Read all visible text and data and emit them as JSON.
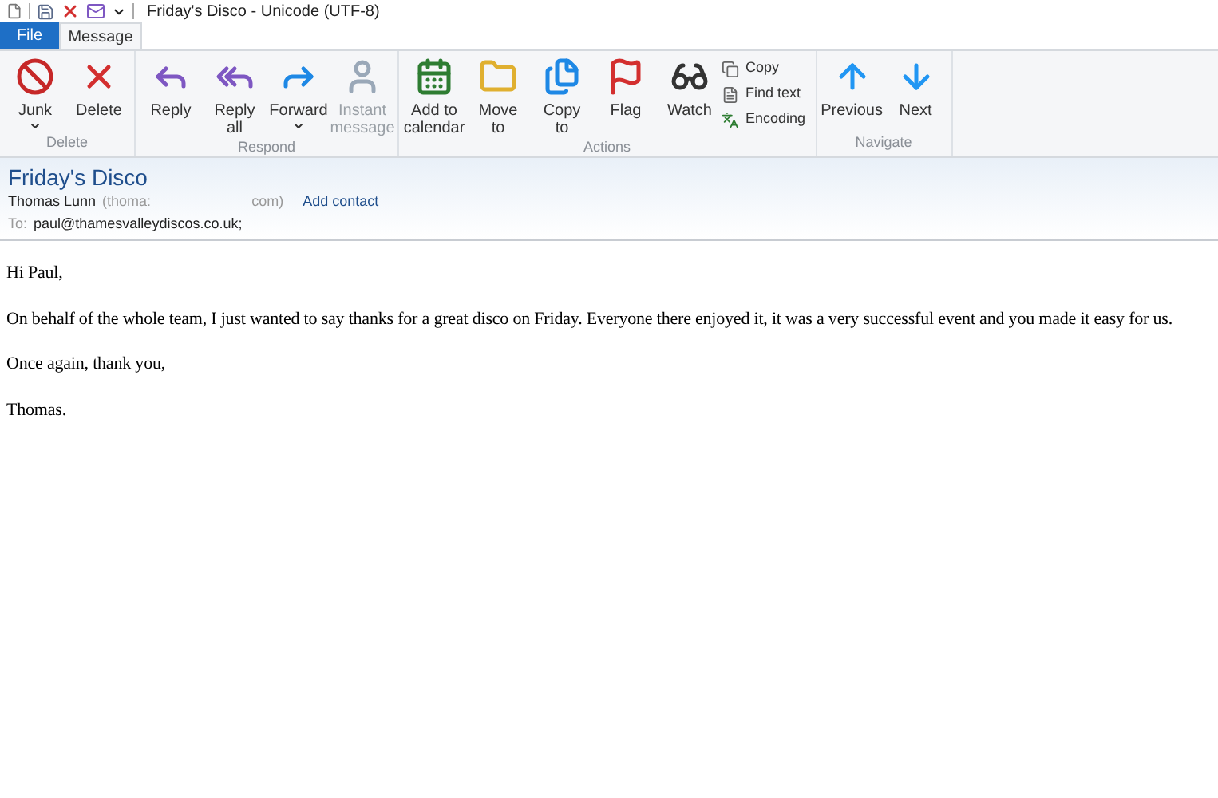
{
  "window": {
    "title": "Friday's Disco  - Unicode (UTF-8)"
  },
  "tabs": [
    {
      "label": "File",
      "selected": false,
      "kind": "file"
    },
    {
      "label": "Message",
      "selected": true,
      "kind": "tab"
    }
  ],
  "ribbon": {
    "groups": [
      {
        "label": "Delete",
        "buttons": [
          {
            "label": "Junk",
            "dropdown": true,
            "disabled": false
          },
          {
            "label": "Delete",
            "dropdown": false,
            "disabled": false
          }
        ]
      },
      {
        "label": "Respond",
        "buttons": [
          {
            "label": "Reply",
            "dropdown": false,
            "disabled": false
          },
          {
            "label": "Reply all",
            "dropdown": false,
            "disabled": false
          },
          {
            "label": "Forward",
            "dropdown": true,
            "disabled": false
          },
          {
            "label": "Instant message",
            "dropdown": false,
            "disabled": true
          }
        ]
      },
      {
        "label": "Actions",
        "buttons": [
          {
            "label": "Add to calendar",
            "dropdown": false,
            "disabled": false
          },
          {
            "label": "Move to",
            "dropdown": false,
            "disabled": false
          },
          {
            "label": "Copy to",
            "dropdown": false,
            "disabled": false
          },
          {
            "label": "Flag",
            "dropdown": false,
            "disabled": false
          },
          {
            "label": "Watch",
            "dropdown": false,
            "disabled": false
          }
        ],
        "small_buttons": [
          {
            "label": "Copy"
          },
          {
            "label": "Find text"
          },
          {
            "label": "Encoding"
          }
        ]
      },
      {
        "label": "Navigate",
        "buttons": [
          {
            "label": "Previous",
            "dropdown": false,
            "disabled": false
          },
          {
            "label": "Next",
            "dropdown": false,
            "disabled": false
          }
        ]
      }
    ]
  },
  "header": {
    "subject": "Friday's Disco",
    "sender": "Thomas Lunn",
    "sender_email_start": "(thoma:",
    "sender_email_end": "com)",
    "add_contact": "Add contact",
    "to_label": "To:",
    "to": "paul@thamesvalleydiscos.co.uk;"
  },
  "body": [
    "Hi Paul,",
    "On behalf of the whole team, I just wanted to say thanks for a great disco on Friday. Everyone there enjoyed it, it was a very successful event and you made it easy for us.",
    "Once again, thank you,",
    "Thomas."
  ]
}
